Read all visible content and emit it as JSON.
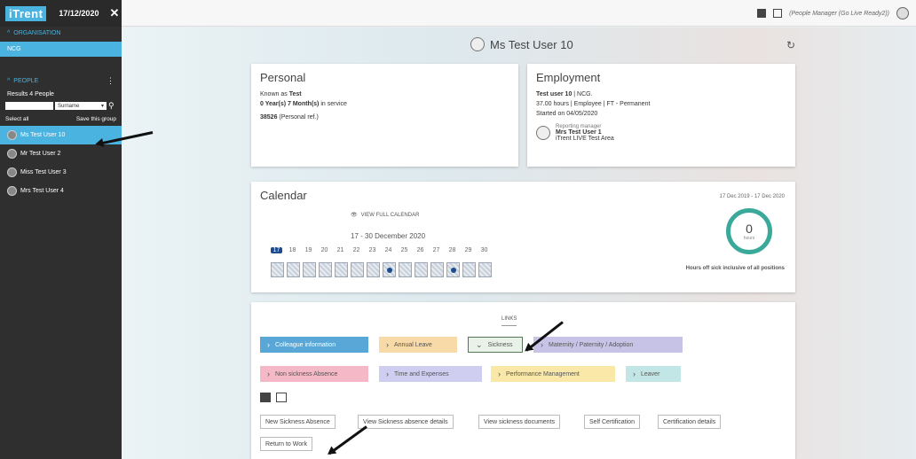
{
  "sidebar": {
    "logo": "iTrent",
    "date": "17/12/2020",
    "org_section": "ORGANISATION",
    "org_value": "NCG",
    "people_section": "PEOPLE",
    "results": "Results 4 People",
    "search_field_value": "Surname",
    "select_all": "Select all",
    "save_group": "Save this group",
    "people": [
      "Ms Test User 10",
      "Mr Test User 2",
      "Miss Test User 3",
      "Mrs Test User 4"
    ]
  },
  "topbar": {
    "role": "(People Manager (Go Live Ready2))"
  },
  "header": {
    "user_name": "Ms Test User 10"
  },
  "personal": {
    "title": "Personal",
    "known_as_label": "Known as",
    "known_as": "Test",
    "service": "0 Year(s) 7 Month(s)",
    "service_suffix": "in service",
    "ref": "38526",
    "ref_suffix": "(Personal ref.)"
  },
  "employment": {
    "title": "Employment",
    "user_line_name": "Test user 10",
    "user_line_org": "| NCG.",
    "hours_line": "37.00 hours | Employee | FT - Permanent",
    "started": "Started on 04/05/2020",
    "manager_label": "Reporting manager",
    "manager_name": "Mrs Test User 1",
    "manager_area": "iTrent LIVE Test Area"
  },
  "calendar": {
    "title": "Calendar",
    "view_full": "VIEW FULL CALENDAR",
    "range": "17 - 30 December 2020",
    "days": [
      "17",
      "18",
      "19",
      "20",
      "21",
      "22",
      "23",
      "24",
      "25",
      "26",
      "27",
      "28",
      "29",
      "30"
    ],
    "today_index": 0,
    "booked_day_indices": [
      7,
      11
    ],
    "hours_range": "17 Dec 2019 - 17 Dec 2020",
    "hours_value": "0",
    "hours_unit": "hours",
    "hours_label": "Hours off sick inclusive of all positions"
  },
  "links": {
    "title": "LINKS",
    "row1": [
      "Colleague information",
      "Annual Leave",
      "Sickness",
      "Maternity / Paternity / Adoption"
    ],
    "row2": [
      "Non sickness Absence",
      "Time and Expenses",
      "Performance Management",
      "Leaver"
    ],
    "actions": [
      "New Sickness Absence",
      "View Sickness absence details",
      "View sickness documents",
      "Self Certification",
      "Certification details",
      "Return to Work"
    ]
  },
  "icons": {
    "close": "close-icon",
    "refresh": "refresh-icon",
    "search": "search-icon",
    "menu": "kebab-menu-icon",
    "eye": "eye-icon"
  },
  "colors": {
    "accent": "#4bb3e0",
    "ring": "#3aa99a",
    "today": "#1d4b8f"
  }
}
